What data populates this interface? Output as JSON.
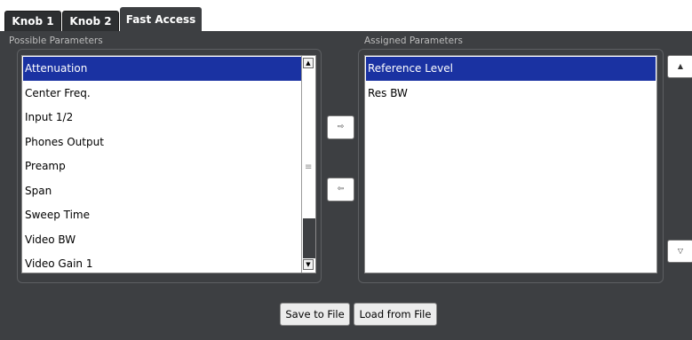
{
  "tabs": [
    {
      "label": "Knob 1"
    },
    {
      "label": "Knob 2"
    },
    {
      "label": "Fast Access"
    }
  ],
  "possible": {
    "title": "Possible Parameters",
    "items": [
      "Attenuation",
      "Center Freq.",
      "Input 1/2",
      "Phones Output",
      "Preamp",
      "Span",
      "Sweep Time",
      "Video BW",
      "Video Gain 1"
    ],
    "selected": "Attenuation"
  },
  "assigned": {
    "title": "Assigned Parameters",
    "items": [
      "Reference Level",
      "Res BW"
    ],
    "selected": "Reference Level"
  },
  "icons": {
    "add": "arrow-right-icon",
    "remove": "arrow-left-icon",
    "move_up": "triangle-up-icon",
    "move_down": "triangle-down-icon"
  },
  "buttons": {
    "save": "Save to File",
    "load": "Load from File"
  },
  "colors": {
    "selection": "#1a32a2",
    "background": "#3d3f42"
  }
}
